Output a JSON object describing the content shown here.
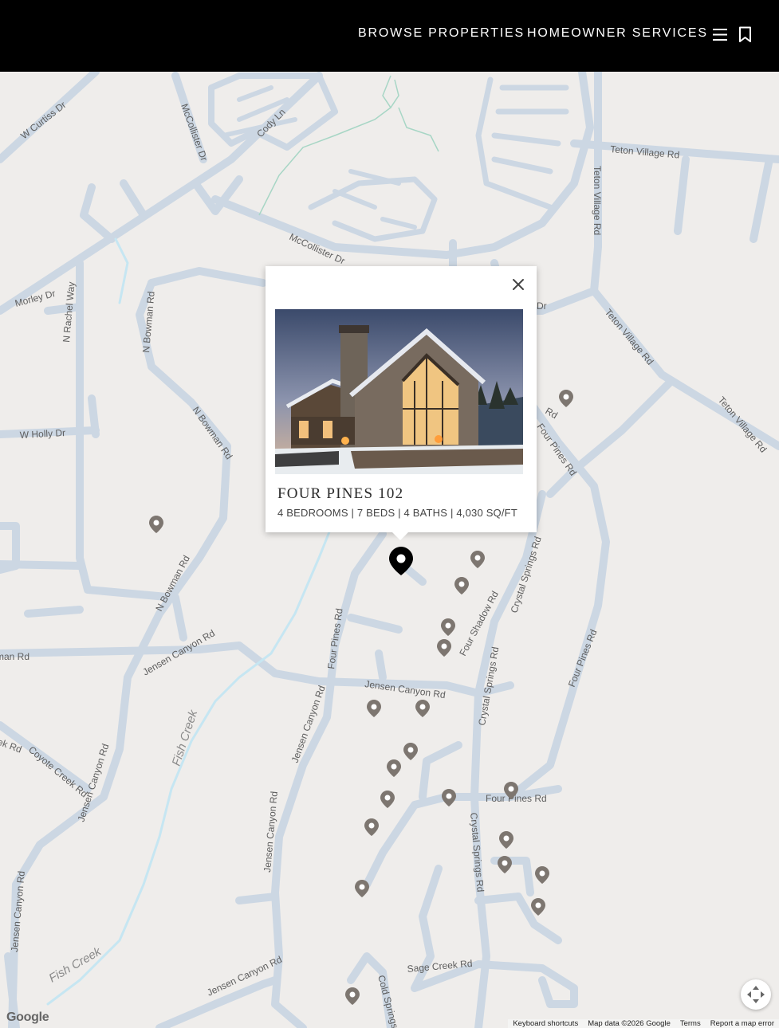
{
  "nav": {
    "browse_label": "BROWSE PROPERTIES",
    "services_label": "HOMEOWNER SERVICES",
    "menu_icon": "hamburger-menu-icon",
    "bookmark_icon": "bookmark-icon"
  },
  "popup": {
    "title": "FOUR PINES 102",
    "specs": "4 BEDROOMS | 7 BEDS | 4 BATHS | 4,030 SQ/FT",
    "close_icon": "close-icon"
  },
  "map": {
    "streets": {
      "w_curtiss": "W Curtiss Dr",
      "mccollister_dr": "McCollister Dr",
      "cody_ln": "Cody Ln",
      "teton_village_rd_top": "Teton Village Rd",
      "teton_village_rd_vert": "Teton Village Rd",
      "mccollister_mid": "McCollister Dr",
      "morley_dr": "Morley Dr",
      "n_rachel_way": "N Rachel Way",
      "n_bowman_rd_1": "N Bowman Rd",
      "teton_village_rd_diag1": "Teton Village Rd",
      "teton_village_rd_diag2": "Teton Village Rd",
      "w_holly_dr": "W Holly Dr",
      "n_bowman_rd_2": "N Bowman Rd",
      "four_pines_rd_1": "Four Pines Rd",
      "dr_partial": "Dr",
      "rd_partial": "Rd",
      "n_bowman_rd_3": "N Bowman Rd",
      "crystal_springs_rd_1": "Crystal Springs Rd",
      "four_shadow_rd": "Four Shadow Rd",
      "man_rd": "man Rd",
      "jensen_canyon_rd_1": "Jensen Canyon Rd",
      "four_pines_rd_2": "Four Pines Rd",
      "four_pines_rd_3": "Four Pines Rd",
      "crystal_springs_rd_2": "Crystal Springs Rd",
      "jensen_canyon_rd_2": "Jensen Canyon Rd",
      "fish_creek_1": "Fish Creek",
      "ek_rd": "ek Rd",
      "coyote_creek_rd": "Coyote Creek Rd",
      "jensen_canyon_rd_3": "Jensen Canyon Rd",
      "jensen_canyon_rd_4": "Jensen Canyon Rd",
      "four_pines_rd_4": "Four Pines Rd",
      "crystal_springs_rd_3": "Crystal Springs Rd",
      "jensen_canyon_rd_5": "Jensen Canyon Rd",
      "jensen_canyon_rd_6": "Jensen Canyon Rd",
      "fish_creek_2": "Fish Creek",
      "jensen_canyon_rd_7": "Jensen Canyon Rd",
      "sage_creek_rd": "Sage Creek Rd",
      "cold_springs": "Cold Springs"
    },
    "pin_icon": "map-pin-icon",
    "fullscreen_icon": "fullscreen-arrows-icon",
    "logo": "Google",
    "attribution": {
      "keyboard": "Keyboard shortcuts",
      "mapdata": "Map data ©2026 Google",
      "terms": "Terms",
      "report": "Report a map error"
    }
  },
  "colors": {
    "header_bg": "#000000",
    "map_bg": "#efedeb",
    "road": "#ccd7e3",
    "pin": "#7d7670",
    "pin_active": "#000000"
  }
}
